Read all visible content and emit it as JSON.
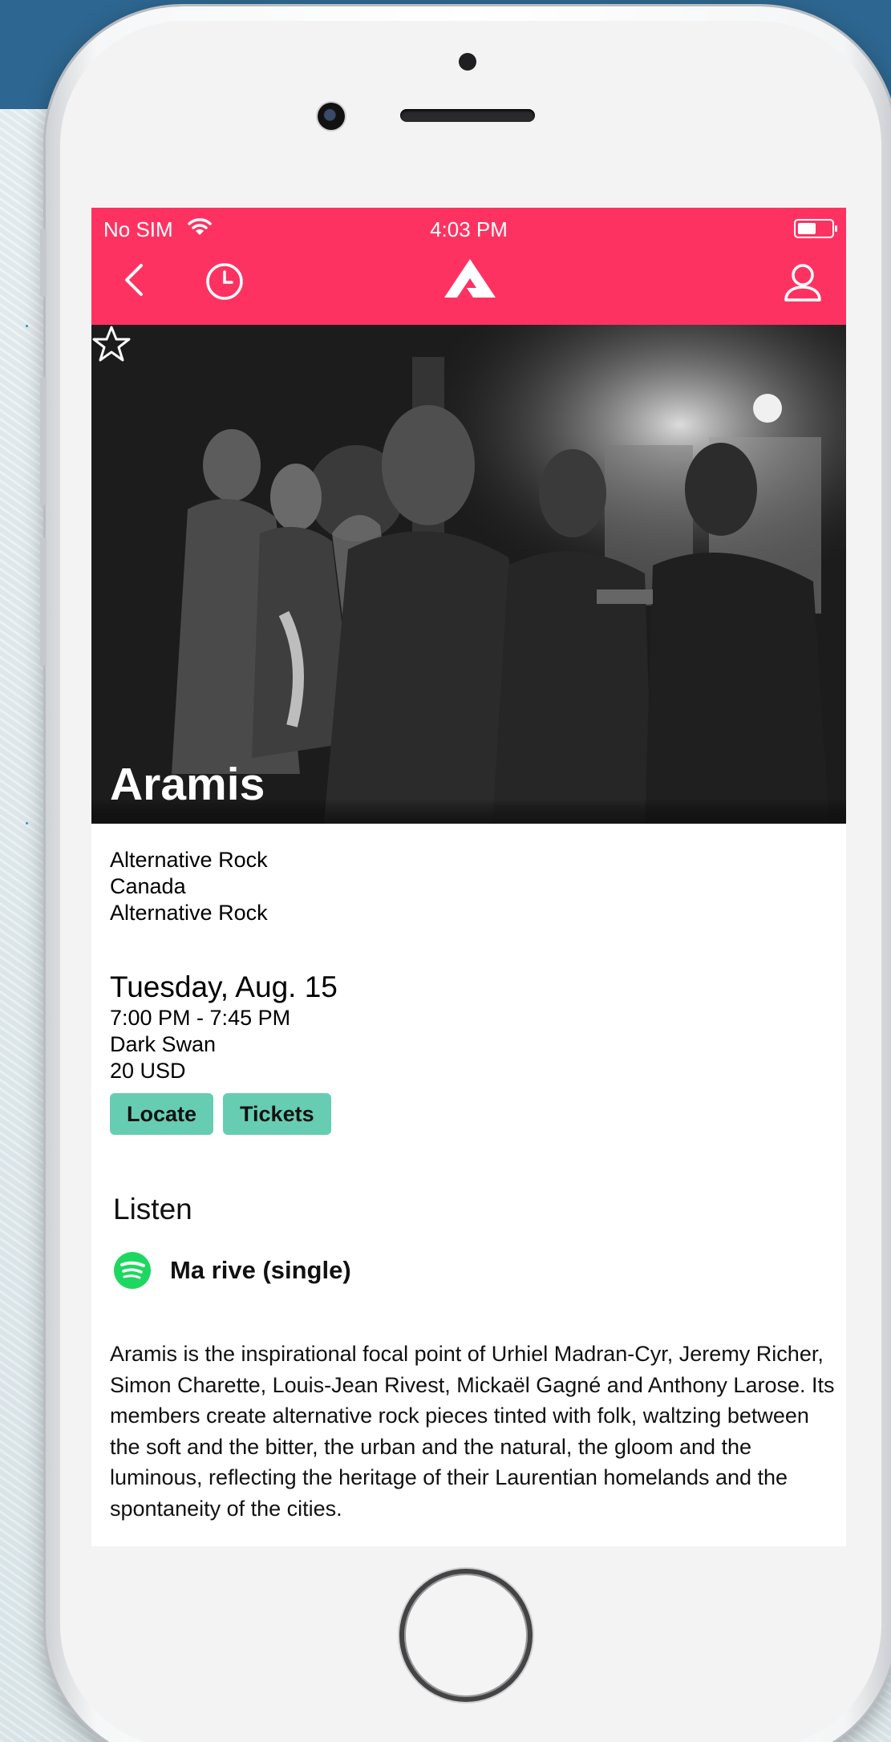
{
  "status_bar": {
    "carrier": "No SIM",
    "time": "4:03 PM"
  },
  "header": {
    "background_color": "#fe3261",
    "icons": [
      "back-icon",
      "history-icon",
      "logo-icon",
      "profile-icon"
    ]
  },
  "artist": {
    "name": "Aramis",
    "genre": "Alternative Rock",
    "country": "Canada",
    "category": "Alternative Rock"
  },
  "event": {
    "date": "Tuesday, Aug. 15",
    "time_range": "7:00 PM - 7:45 PM",
    "venue": "Dark Swan",
    "price": "20 USD"
  },
  "actions": {
    "locate_label": "Locate",
    "tickets_label": "Tickets",
    "button_color": "#66cdb3"
  },
  "listen": {
    "heading": "Listen",
    "track": "Ma rive (single)",
    "service_icon": "spotify-icon"
  },
  "bio": "Aramis is the inspirational focal point of Urhiel Madran-Cyr, Jeremy Richer, Simon Charette, Louis-Jean Rivest, Mickaël Gagné and Anthony Larose. Its members create alternative rock pieces tinted with folk, waltzing between the soft and the bitter, the urban and the natural, the gloom and the luminous, reflecting the heritage of their Laurentian homelands and the spontaneity of the cities."
}
